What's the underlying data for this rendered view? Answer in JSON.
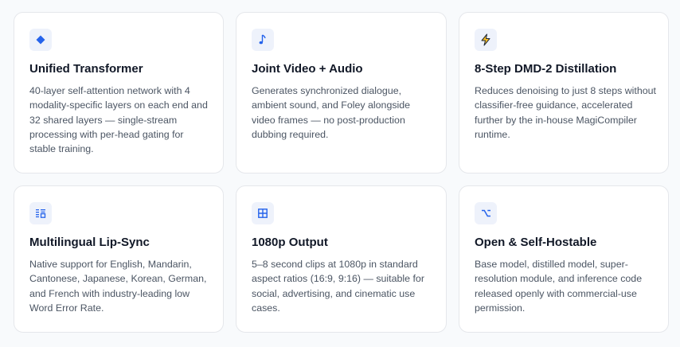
{
  "colors": {
    "accent": "#2563eb",
    "icon_bg": "#eef2fb",
    "card_border": "#e5e7eb",
    "title": "#111827",
    "text": "#4b5563",
    "bolt_fill": "#fbbf24"
  },
  "cards": [
    {
      "icon": "diamond-icon",
      "title": "Unified Transformer",
      "description": "40-layer self-attention network with 4 modality-specific layers on each end and 32 shared layers — single-stream processing with per-head gating for stable training."
    },
    {
      "icon": "music-note-icon",
      "title": "Joint Video + Audio",
      "description": "Generates synchronized dialogue, ambient sound, and Foley alongside video frames — no post-production dubbing required."
    },
    {
      "icon": "lightning-bolt-icon",
      "title": "8-Step DMD-2 Distillation",
      "description": "Reduces denoising to just 8 steps without classifier-free guidance, accelerated further by the in-house MagiCompiler runtime."
    },
    {
      "icon": "language-icon",
      "title": "Multilingual Lip-Sync",
      "description": "Native support for English, Mandarin, Cantonese, Japanese, Korean, German, and French with industry-leading low Word Error Rate."
    },
    {
      "icon": "grid-frame-icon",
      "title": "1080p Output",
      "description": "5–8 second clips at 1080p in standard aspect ratios (16:9, 9:16) — suitable for social, advertising, and cinematic use cases."
    },
    {
      "icon": "option-key-icon",
      "title": "Open & Self-Hostable",
      "description": "Base model, distilled model, super-resolution module, and inference code released openly with commercial-use permission."
    }
  ]
}
